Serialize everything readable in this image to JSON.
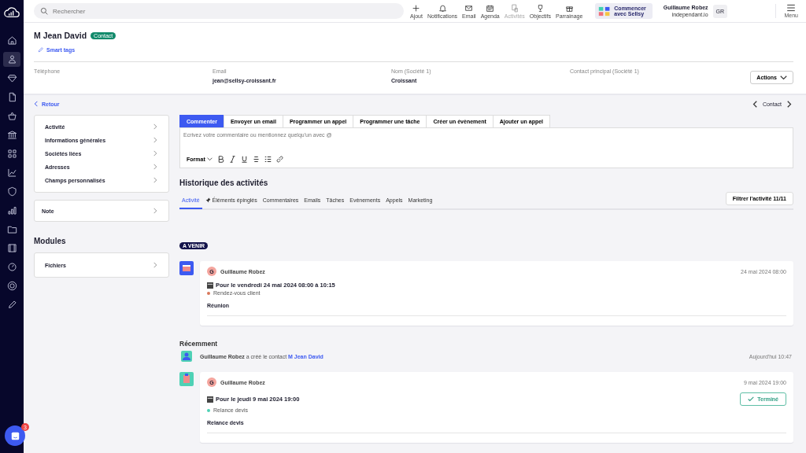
{
  "sidebar": {
    "items": [
      {
        "selected": false
      },
      {
        "selected": true
      },
      {
        "selected": false
      },
      {
        "selected": false
      },
      {
        "selected": false
      },
      {
        "selected": false
      },
      {
        "selected": false
      },
      {
        "selected": false
      },
      {
        "selected": false
      },
      {
        "selected": false
      },
      {
        "selected": false
      },
      {
        "selected": false
      },
      {
        "selected": false
      },
      {
        "selected": false
      },
      {
        "selected": false
      }
    ]
  },
  "topbar": {
    "search": {
      "placeholder": "Rechercher"
    },
    "actions": [
      {
        "label": "Ajout",
        "disabled": false
      },
      {
        "label": "Notifications",
        "disabled": false
      },
      {
        "label": "Email",
        "disabled": false
      },
      {
        "label": "Agenda",
        "disabled": false
      },
      {
        "label": "Activités",
        "disabled": true
      },
      {
        "label": "Objectifs",
        "disabled": false
      },
      {
        "label": "Parrainage",
        "disabled": false
      }
    ],
    "onboarding": {
      "lines": [
        "Commencer",
        "avec Sellsy"
      ]
    },
    "user": {
      "name": "Guillaume Robez",
      "company": "independant.io",
      "initials": "GR"
    },
    "menu": {
      "label": "Menu"
    }
  },
  "contact": {
    "name": "M Jean David",
    "badge": "Contact",
    "smart_tags": "Smart tags",
    "fields": [
      {
        "label": "Téléphone"
      },
      {
        "label": "Email",
        "value": "jean@sellsy-croissant.fr"
      },
      {
        "label": "Nom (Société 1)",
        "value": "Croissant"
      },
      {
        "label": "Contact principal (Société 1)"
      }
    ],
    "actions_button": "Actions"
  },
  "back_link": "Retour",
  "pager": {
    "label": "Contact"
  },
  "left_menu": {
    "items": [
      "Activité",
      "Informations générales",
      "Sociétés liées",
      "Adresses",
      "Champs personnalisés"
    ],
    "note": "Note",
    "modules_title": "Modules",
    "modules": [
      "Fichiers"
    ]
  },
  "composer": {
    "tabs": [
      {
        "label": "Commenter",
        "selected": true
      },
      {
        "label": "Envoyer un email",
        "selected": false
      },
      {
        "label": "Programmer un appel",
        "selected": false
      },
      {
        "label": "Programmer une tâche",
        "selected": false
      },
      {
        "label": "Créer un évènement",
        "selected": false
      },
      {
        "label": "Ajouter un appel",
        "selected": false
      }
    ],
    "placeholder": "Ecrivez votre commentaire ou mentionnez quelqu'un avec @",
    "format_label": "Format"
  },
  "history": {
    "title": "Historique des activités",
    "tabs": [
      {
        "label": "Activité",
        "selected": true
      },
      {
        "label": "Éléments épinglés",
        "selected": false,
        "pinned": true
      },
      {
        "label": "Commentaires",
        "selected": false
      },
      {
        "label": "Emails",
        "selected": false
      },
      {
        "label": "Tâches",
        "selected": false
      },
      {
        "label": "Evènements",
        "selected": false
      },
      {
        "label": "Appels",
        "selected": false
      },
      {
        "label": "Marketing",
        "selected": false
      }
    ],
    "filter_button": "Filtrer l'activité 11/11",
    "upcoming_label": "A VENIR",
    "upcoming": [
      {
        "kind": "event",
        "avatar": "G",
        "author": "Guillaume Robez",
        "date": "24 mai 2024 08:00",
        "title": "Pour le vendredi 24 mai 2024 08:00 à 10:15",
        "tag": {
          "label": "Rendez-vous client",
          "color": "#d9785a"
        },
        "body": "Réunion"
      }
    ],
    "recent_label": "Récemment",
    "log": {
      "actor": "Guillaume Robez",
      "text": "a créé le contact",
      "link": "M Jean David",
      "time": "Aujourd'hui 10:47"
    },
    "recent": [
      {
        "kind": "task",
        "avatar": "G",
        "author": "Guillaume Robez",
        "date": "9 mai 2024 19:00",
        "title": "Pour le jeudi 9 mai 2024 19:00",
        "tag": {
          "label": "Relance devis",
          "color": "#4fd1b5"
        },
        "body": "Relance devis",
        "status": "Terminé"
      }
    ]
  },
  "chat": {
    "badge": "3"
  }
}
